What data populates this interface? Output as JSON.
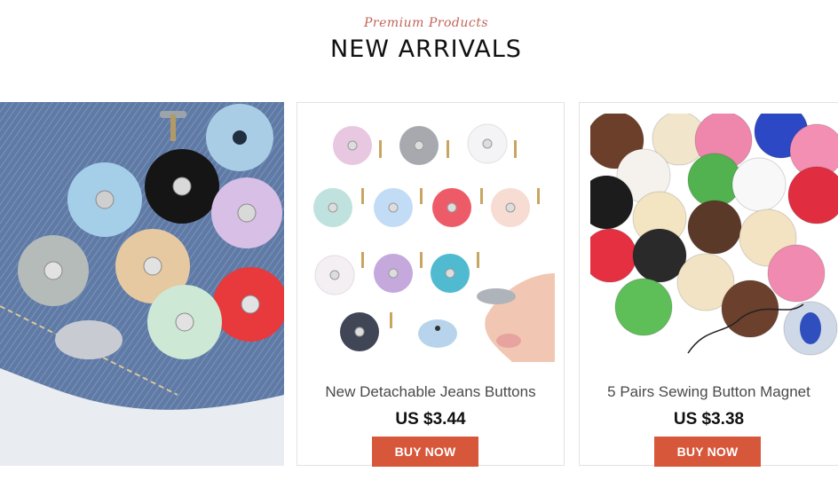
{
  "header": {
    "subtitle": "Premium Products",
    "title": "NEW ARRIVALS"
  },
  "products": [
    {
      "name": "New Detachable Jeans Buttons",
      "price": "US $3.44",
      "button_label": "BUY NOW"
    },
    {
      "name": "5 Pairs Sewing Button Magnet",
      "price": "US $3.38",
      "button_label": "BUY NOW"
    }
  ],
  "colors": {
    "accent": "#d7573b",
    "subtitle": "#c0655a"
  }
}
